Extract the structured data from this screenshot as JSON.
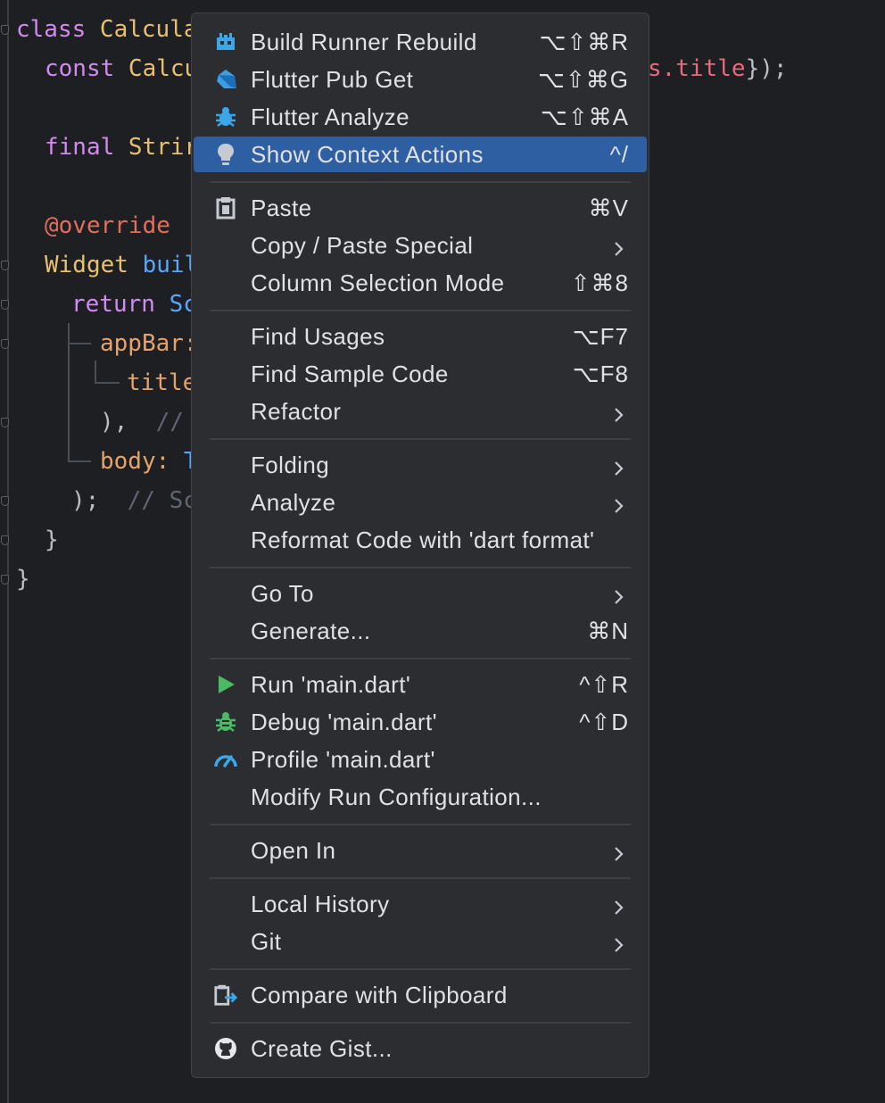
{
  "editor": {
    "code": [
      {
        "parts": [
          {
            "t": "class ",
            "c": "kw"
          },
          {
            "t": "Calcula",
            "c": "cls"
          }
        ]
      },
      {
        "parts": [
          {
            "t": "const ",
            "c": "kw"
          },
          {
            "t": "Calcu",
            "c": "cls"
          }
        ]
      },
      {
        "parts": [
          {
            "t": "final ",
            "c": "kw"
          },
          {
            "t": "Strir",
            "c": "cls"
          }
        ]
      },
      {
        "parts": [
          {
            "t": "@override",
            "c": "ann"
          }
        ]
      },
      {
        "parts": [
          {
            "t": "Widget ",
            "c": "cls"
          },
          {
            "t": "buil",
            "c": "fn"
          }
        ]
      },
      {
        "parts": [
          {
            "t": "return ",
            "c": "kw"
          },
          {
            "t": "Sc",
            "c": "fn"
          }
        ]
      },
      {
        "parts": [
          {
            "t": "appBar:",
            "c": "prop"
          }
        ]
      },
      {
        "parts": [
          {
            "t": "title",
            "c": "prop"
          }
        ]
      },
      {
        "parts": [
          {
            "t": "),  ",
            "c": ""
          },
          {
            "t": "//",
            "c": "cmt"
          }
        ]
      },
      {
        "parts": [
          {
            "t": "body: ",
            "c": "prop"
          },
          {
            "t": "T",
            "c": "fn"
          }
        ]
      },
      {
        "parts": [
          {
            "t": ");  ",
            "c": ""
          },
          {
            "t": "// Sc",
            "c": "cmt"
          }
        ]
      },
      {
        "parts": [
          {
            "t": "}",
            "c": ""
          }
        ]
      },
      {
        "parts": [
          {
            "t": "}",
            "c": ""
          }
        ]
      }
    ],
    "right_fragment": [
      {
        "t": "s.title",
        "c": "str"
      },
      {
        "t": "});",
        "c": ""
      }
    ]
  },
  "menu": {
    "items": [
      {
        "id": "build-runner-rebuild",
        "label": "Build Runner Rebuild",
        "shortcut": "⌥⇧⌘R",
        "icon": "build-runner-icon"
      },
      {
        "id": "flutter-pub-get",
        "label": "Flutter Pub Get",
        "shortcut": "⌥⇧⌘G",
        "icon": "dart-icon"
      },
      {
        "id": "flutter-analyze",
        "label": "Flutter Analyze",
        "shortcut": "⌥⇧⌘A",
        "icon": "bug-icon"
      },
      {
        "id": "show-context-actions",
        "label": "Show Context Actions",
        "shortcut": "^/",
        "icon": "lightbulb-icon",
        "selected": true
      },
      {
        "id": "paste",
        "label": "Paste",
        "shortcut": "⌘V",
        "icon": "clipboard-icon"
      },
      {
        "id": "copy-paste-special",
        "label": "Copy / Paste Special",
        "submenu": true
      },
      {
        "id": "column-selection-mode",
        "label": "Column Selection Mode",
        "shortcut": "⇧⌘8"
      },
      {
        "id": "find-usages",
        "label": "Find Usages",
        "shortcut": "⌥F7"
      },
      {
        "id": "find-sample-code",
        "label": "Find Sample Code",
        "shortcut": "⌥F8"
      },
      {
        "id": "refactor",
        "label": "Refactor",
        "submenu": true
      },
      {
        "id": "folding",
        "label": "Folding",
        "submenu": true
      },
      {
        "id": "analyze",
        "label": "Analyze",
        "submenu": true
      },
      {
        "id": "reformat-code",
        "label": "Reformat Code with 'dart format'"
      },
      {
        "id": "go-to",
        "label": "Go To",
        "submenu": true
      },
      {
        "id": "generate",
        "label": "Generate...",
        "shortcut": "⌘N"
      },
      {
        "id": "run-main",
        "label": "Run 'main.dart'",
        "shortcut": "^⇧R",
        "icon": "run-icon"
      },
      {
        "id": "debug-main",
        "label": "Debug 'main.dart'",
        "shortcut": "^⇧D",
        "icon": "debug-icon"
      },
      {
        "id": "profile-main",
        "label": "Profile 'main.dart'",
        "icon": "profile-gauge-icon"
      },
      {
        "id": "modify-run-config",
        "label": "Modify Run Configuration..."
      },
      {
        "id": "open-in",
        "label": "Open In",
        "submenu": true
      },
      {
        "id": "local-history",
        "label": "Local History",
        "submenu": true
      },
      {
        "id": "git",
        "label": "Git",
        "submenu": true
      },
      {
        "id": "compare-clipboard",
        "label": "Compare with Clipboard",
        "icon": "compare-clipboard-icon"
      },
      {
        "id": "create-gist",
        "label": "Create Gist...",
        "icon": "github-icon"
      }
    ]
  },
  "colors": {
    "menu_bg": "#2b2d30",
    "selection": "#2e5fa3",
    "editor_bg": "#1e1f22"
  }
}
